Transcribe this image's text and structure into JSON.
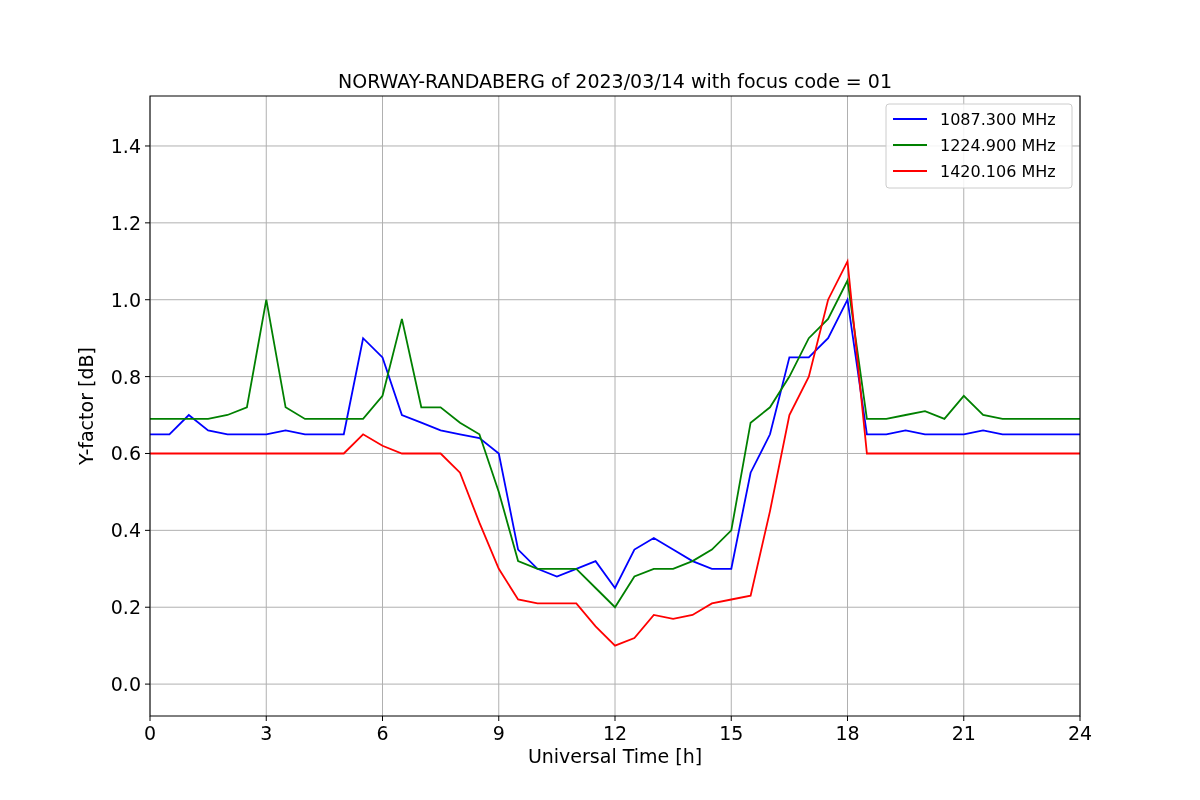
{
  "chart_data": {
    "type": "line",
    "title": "NORWAY-RANDABERG of 2023/03/14 with focus code = 01",
    "xlabel": "Universal Time [h]",
    "ylabel": "Y-factor [dB]",
    "x": [
      0,
      0.5,
      1,
      1.5,
      2,
      2.5,
      3,
      3.5,
      4,
      4.5,
      5,
      5.5,
      6,
      6.5,
      7,
      7.5,
      8,
      8.5,
      9,
      9.5,
      10,
      10.5,
      11,
      11.5,
      12,
      12.5,
      13,
      13.5,
      14,
      14.5,
      15,
      15.5,
      16,
      16.5,
      17,
      17.5,
      18,
      18.5,
      19,
      19.5,
      20,
      20.5,
      21,
      21.5,
      22,
      22.5,
      23,
      23.5,
      24
    ],
    "series": [
      {
        "name": "1087.300 MHz",
        "color": "#0000ff",
        "values": [
          0.65,
          0.65,
          0.7,
          0.66,
          0.65,
          0.65,
          0.65,
          0.66,
          0.65,
          0.65,
          0.65,
          0.9,
          0.85,
          0.7,
          0.68,
          0.66,
          0.65,
          0.64,
          0.6,
          0.35,
          0.3,
          0.28,
          0.3,
          0.32,
          0.25,
          0.35,
          0.38,
          0.35,
          0.32,
          0.3,
          0.3,
          0.55,
          0.65,
          0.85,
          0.85,
          0.9,
          1.0,
          0.65,
          0.65,
          0.66,
          0.65,
          0.65,
          0.65,
          0.66,
          0.65,
          0.65,
          0.65,
          0.65,
          0.65
        ]
      },
      {
        "name": "1224.900 MHz",
        "color": "#008000",
        "values": [
          0.69,
          0.69,
          0.69,
          0.69,
          0.7,
          0.72,
          1.0,
          0.72,
          0.69,
          0.69,
          0.69,
          0.69,
          0.75,
          0.95,
          0.72,
          0.72,
          0.68,
          0.65,
          0.5,
          0.32,
          0.3,
          0.3,
          0.3,
          0.25,
          0.2,
          0.28,
          0.3,
          0.3,
          0.32,
          0.35,
          0.4,
          0.68,
          0.72,
          0.8,
          0.9,
          0.95,
          1.05,
          0.69,
          0.69,
          0.7,
          0.71,
          0.69,
          0.75,
          0.7,
          0.69,
          0.69,
          0.69,
          0.69,
          0.69
        ]
      },
      {
        "name": "1420.106 MHz",
        "color": "#ff0000",
        "values": [
          0.6,
          0.6,
          0.6,
          0.6,
          0.6,
          0.6,
          0.6,
          0.6,
          0.6,
          0.6,
          0.6,
          0.65,
          0.62,
          0.6,
          0.6,
          0.6,
          0.55,
          0.42,
          0.3,
          0.22,
          0.21,
          0.21,
          0.21,
          0.15,
          0.1,
          0.12,
          0.18,
          0.17,
          0.18,
          0.21,
          0.22,
          0.23,
          0.45,
          0.7,
          0.8,
          1.0,
          1.1,
          0.6,
          0.6,
          0.6,
          0.6,
          0.6,
          0.6,
          0.6,
          0.6,
          0.6,
          0.6,
          0.6,
          0.6
        ]
      }
    ],
    "xlim": [
      0,
      24
    ],
    "ylim": [
      -0.083,
      1.53
    ],
    "xticks": [
      0,
      3,
      6,
      9,
      12,
      15,
      18,
      21,
      24
    ],
    "yticks": [
      {
        "value": 0,
        "label": "0.0"
      },
      {
        "value": 0.2,
        "label": "0.2"
      },
      {
        "value": 0.4,
        "label": "0.4"
      },
      {
        "value": 0.6,
        "label": "0.6"
      },
      {
        "value": 0.8,
        "label": "0.8"
      },
      {
        "value": 1,
        "label": "1.0"
      },
      {
        "value": 1.2,
        "label": "1.2"
      },
      {
        "value": 1.4,
        "label": "1.4"
      }
    ],
    "grid": true,
    "legend": true
  }
}
